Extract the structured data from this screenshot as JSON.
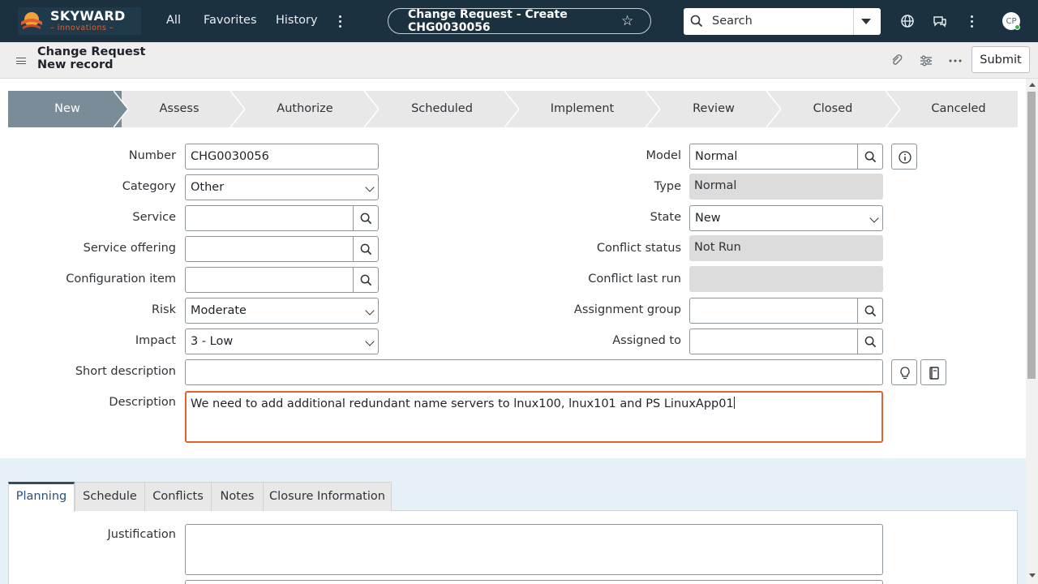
{
  "brand": {
    "name": "SKYWARD",
    "tagline": "– innovations –"
  },
  "nav": {
    "all": "All",
    "favorites": "Favorites",
    "history": "History"
  },
  "context_pill": {
    "label": "Change Request - Create CHG0030056"
  },
  "search": {
    "label": "Search"
  },
  "user": {
    "initials": "CP"
  },
  "record": {
    "type": "Change Request",
    "status": "New record",
    "submit_label": "Submit"
  },
  "stages": [
    "New",
    "Assess",
    "Authorize",
    "Scheduled",
    "Implement",
    "Review",
    "Closed",
    "Canceled"
  ],
  "fields": {
    "number": {
      "label": "Number",
      "value": "CHG0030056"
    },
    "category": {
      "label": "Category",
      "value": "Other"
    },
    "service": {
      "label": "Service",
      "value": ""
    },
    "service_offering": {
      "label": "Service offering",
      "value": ""
    },
    "configuration_item": {
      "label": "Configuration item",
      "value": ""
    },
    "risk": {
      "label": "Risk",
      "value": "Moderate"
    },
    "impact": {
      "label": "Impact",
      "value": "3 - Low"
    },
    "short_description": {
      "label": "Short description",
      "value": ""
    },
    "description": {
      "label": "Description",
      "value": "We need to add additional redundant name servers to lnux100, lnux101 and PS LinuxApp01"
    },
    "model": {
      "label": "Model",
      "value": "Normal"
    },
    "type": {
      "label": "Type",
      "value": "Normal"
    },
    "state": {
      "label": "State",
      "value": "New"
    },
    "conflict_status": {
      "label": "Conflict status",
      "value": "Not Run"
    },
    "conflict_last_run": {
      "label": "Conflict last run",
      "value": ""
    },
    "assignment_group": {
      "label": "Assignment group",
      "value": ""
    },
    "assigned_to": {
      "label": "Assigned to",
      "value": ""
    }
  },
  "tabs": [
    "Planning",
    "Schedule",
    "Conflicts",
    "Notes",
    "Closure Information"
  ],
  "planning": {
    "justification_label": "Justification"
  },
  "colors": {
    "nav_bg": "#1b3140",
    "accent_orange": "#e0622f",
    "active_stage": "#7a8c98"
  }
}
